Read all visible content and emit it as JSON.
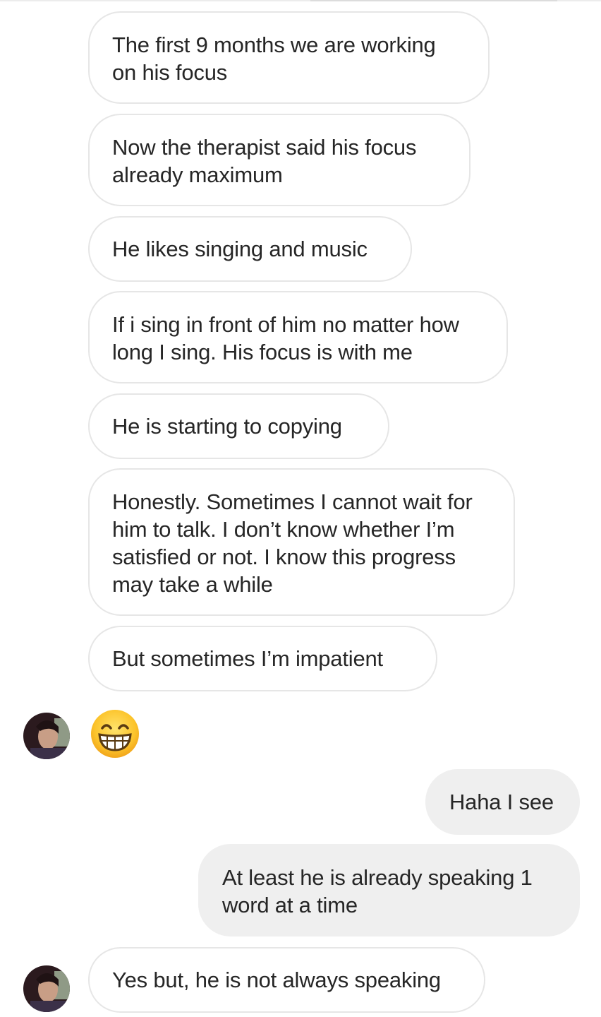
{
  "conversation": {
    "messages": [
      {
        "sender": "them",
        "text": "The first 9 months we are working on his focus"
      },
      {
        "sender": "them",
        "text": "Now the therapist said his focus already maximum"
      },
      {
        "sender": "them",
        "text": "He likes singing and music"
      },
      {
        "sender": "them",
        "text": "If i sing in front of him no matter how long I sing. His focus is with me"
      },
      {
        "sender": "them",
        "text": "He is starting to copying"
      },
      {
        "sender": "them",
        "text": "Honestly. Sometimes I cannot wait for him to talk. I don’t know whether I’m satisfied or not. I know this progress may take a while"
      },
      {
        "sender": "them",
        "text": "But sometimes I’m impatient"
      },
      {
        "sender": "them",
        "emoji": "grinning-face-with-smiling-eyes"
      },
      {
        "sender": "me",
        "text": "Haha I see"
      },
      {
        "sender": "me",
        "text": "At least he is already speaking 1 word at a time"
      },
      {
        "sender": "them",
        "text": "Yes but, he is not always speaking"
      }
    ]
  },
  "colors": {
    "incoming_bubble_bg": "#ffffff",
    "incoming_bubble_border": "#e6e6e6",
    "outgoing_bubble_bg": "#efefef",
    "text": "#262626",
    "emoji_face": "#fbc02d"
  }
}
